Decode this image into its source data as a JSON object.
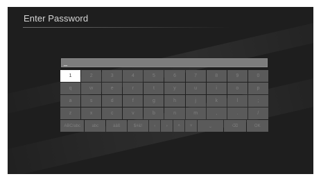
{
  "screen": {
    "title": "Enter Password"
  },
  "password_field": {
    "value": "_"
  },
  "keyboard": {
    "rows": [
      [
        "1",
        "2",
        "3",
        "4",
        "5",
        "6",
        "7",
        "8",
        "9",
        "0"
      ],
      [
        "q",
        "w",
        "e",
        "r",
        "t",
        "y",
        "u",
        "i",
        "o",
        "p"
      ],
      [
        "a",
        "s",
        "d",
        "f",
        "g",
        "h",
        "j",
        "k",
        "l",
        ";"
      ],
      [
        "z",
        "x",
        "c",
        "v",
        "b",
        "n",
        "m",
        ",",
        ".",
        "/"
      ]
    ],
    "bottom_row": {
      "mode_abc": "ABC/abc",
      "symbols": "abc",
      "accents": "àäß",
      "special": "$#&!",
      "arrow_left": "‹",
      "arrow_right": "›",
      "arrow_up": "˄",
      "arrow_down": "˅",
      "space": "⎵",
      "backspace": "⌫",
      "ok": "OK"
    },
    "selected_key": "1"
  },
  "colors": {
    "background": "#1e1e1e",
    "key": "#5a5a5a",
    "key_selected": "#ffffff",
    "field": "#7d7d7d"
  }
}
